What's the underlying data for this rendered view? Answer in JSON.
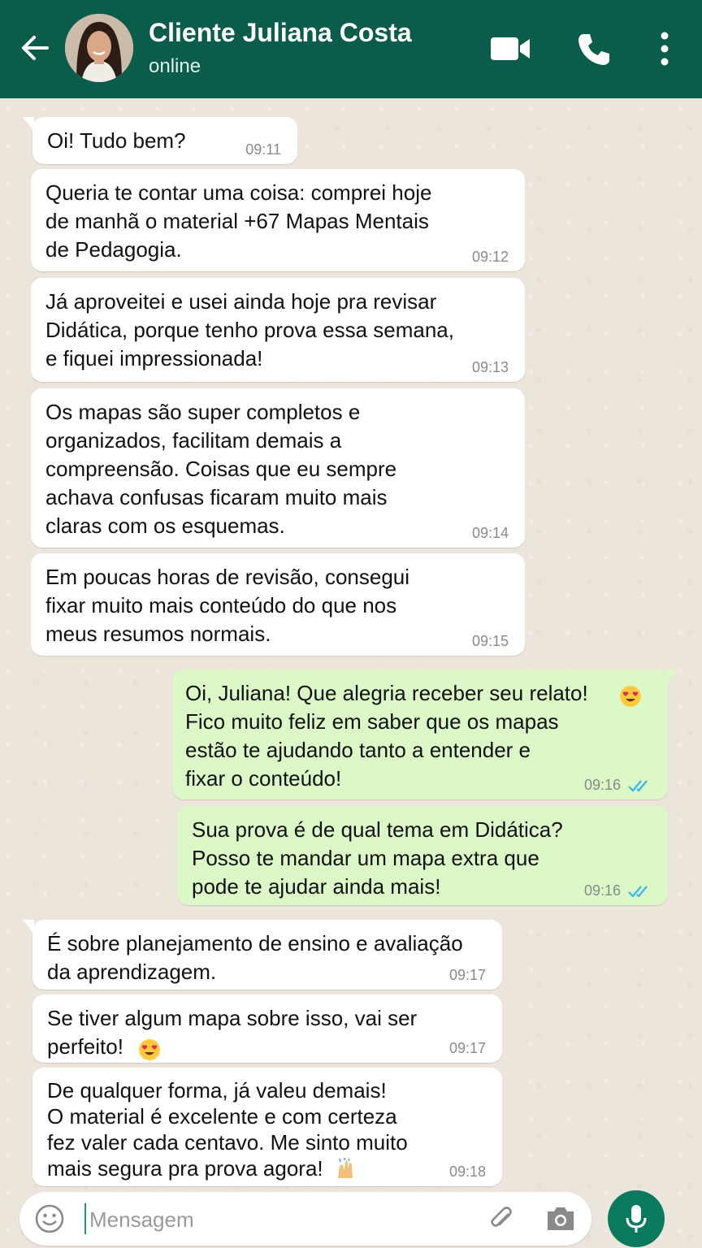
{
  "header": {
    "contact_name": "Cliente Juliana Costa",
    "status": "online",
    "icons": [
      "back-arrow-icon",
      "avatar",
      "video-call-icon",
      "voice-call-icon",
      "more-options-icon"
    ],
    "bg_color": "#0a5c4b"
  },
  "messages": [
    {
      "dir": "in",
      "text": "Oi! Tudo bem?",
      "time": "09:11"
    },
    {
      "dir": "in",
      "text": "Queria te contar uma coisa: comprei hoje\nde manhã o material +67 Mapas Mentais\nde Pedagogia.",
      "time": "09:12"
    },
    {
      "dir": "in",
      "text": "Já aproveitei e usei ainda hoje pra revisar\nDidática, porque tenho prova essa semana,\ne fiquei impressionada!",
      "time": "09:13"
    },
    {
      "dir": "in",
      "text": "Os mapas são super completos e\norganizados, facilitam demais a\ncompreensão. Coisas que eu sempre\nachava confusas ficaram muito mais\nclaras com os esquemas.",
      "time": "09:14"
    },
    {
      "dir": "in",
      "text": "Em poucas horas de revisão, consegui\nfixar muito mais conteúdo do que nos\nmeus resumos normais.",
      "time": "09:15"
    },
    {
      "dir": "out",
      "text": "Oi, Juliana! Que alegria receber seu relato!\nFico muito feliz em saber que os mapas\nestão te ajudando tanto a entender e\nfixar o conteúdo!",
      "emoji": "heart-eyes-emoji",
      "time": "09:16",
      "status": "read"
    },
    {
      "dir": "out",
      "text": "Sua prova é de qual tema em Didática?\nPosso te mandar um mapa extra que\npode te ajudar ainda mais!",
      "time": "09:16",
      "status": "read"
    },
    {
      "dir": "in",
      "text": "É sobre planejamento de ensino e avaliação\nda aprendizagem.",
      "time": "09:17"
    },
    {
      "dir": "in",
      "text": "Se tiver algum mapa sobre isso, vai ser\nperfeito!",
      "emoji": "heart-eyes-emoji",
      "time": "09:17"
    },
    {
      "dir": "in",
      "text": "De qualquer forma, já valeu demais!\nO material é excelente e com certeza\nfez valer cada centavo. Me sinto muito\nmais segura pra prova agora!",
      "emoji": "raised-hands-emoji",
      "time": "09:18"
    }
  ],
  "composer": {
    "placeholder": "Mensagem",
    "value": ""
  },
  "colors": {
    "incoming": "#ffffff",
    "outgoing": "#dcf8c6",
    "read_ticks": "#34b7f1",
    "mic_button": "#0a7a5e"
  }
}
